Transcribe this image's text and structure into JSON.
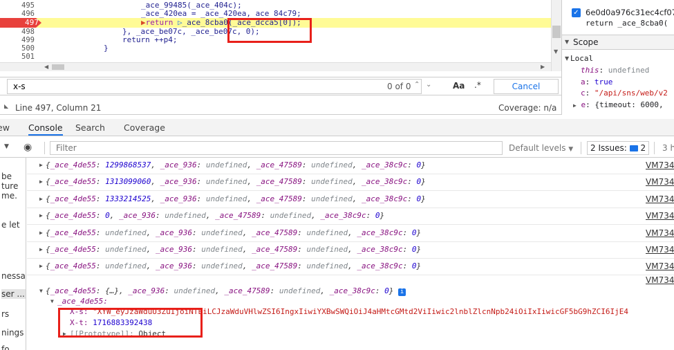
{
  "editor": {
    "breakpoint_label": "497",
    "lines": [
      {
        "num": "495",
        "code": "_ace_99485(_ace_404c);"
      },
      {
        "num": "496",
        "code": "_ace_420ea = _ace_420ea, ace 84c79;"
      },
      {
        "num": "497",
        "code_prefix": "return ",
        "code_fn": "_ace_8cba0(",
        "code_arg": "_ace_dcca5[0]",
        "code_suffix": ");"
      },
      {
        "num": "498",
        "code": "}, _ace_be07c, _ace_be07c, 0);"
      },
      {
        "num": "499",
        "code": "return ++p4;"
      },
      {
        "num": "500",
        "code": "}"
      },
      {
        "num": "501",
        "code": ""
      }
    ]
  },
  "find": {
    "value": "x-s",
    "result": "0 of 0",
    "case_label": "Aa",
    "regex_label": ".*",
    "cancel_label": "Cancel"
  },
  "status": {
    "position": "Line 497, Column 21",
    "coverage": "Coverage: n/a"
  },
  "right_panel": {
    "callstack_line1": "6e0d0a976c31ec4cf07",
    "callstack_line2": "return _ace_8cba0(",
    "scope_label": "Scope",
    "local_label": "Local",
    "scope_items": [
      {
        "key": "this",
        "value": "undefined"
      },
      {
        "key": "a",
        "value": "true"
      },
      {
        "key": "c",
        "value": "\"/api/sns/web/v2"
      },
      {
        "key": "e",
        "value": "{timeout: 6000,"
      }
    ]
  },
  "tabs": {
    "partial_left": "ew",
    "console": "Console",
    "search": "Search",
    "coverage": "Coverage"
  },
  "filter": {
    "placeholder": "Filter",
    "levels": "Default levels",
    "issues_text": "2 Issues:",
    "issues_count": "2",
    "hidden": "3 h"
  },
  "left_column": [
    "be",
    "ture",
    "me.",
    "e let",
    "nessa...",
    "ser ...",
    "rs",
    "nings",
    "fo"
  ],
  "console_rows": [
    {
      "n1": "1299868537",
      "n1_kind": "n",
      "link": "VM7348"
    },
    {
      "n1": "1313099060",
      "n1_kind": "n",
      "link": "VM7348"
    },
    {
      "n1": "1333214525",
      "n1_kind": "n",
      "link": "VM7348"
    },
    {
      "n1": "0",
      "n1_kind": "n",
      "link": "VM7348"
    },
    {
      "n1": "undefined",
      "n1_kind": "u",
      "link": "VM7348"
    },
    {
      "n1": "undefined",
      "n1_kind": "u",
      "link": "VM7348"
    },
    {
      "n1": "undefined",
      "n1_kind": "u",
      "link": "VM7348"
    }
  ],
  "expanded": {
    "link": "VM7348",
    "summary_key": "_ace_4de55",
    "summary_val": "{…}",
    "child_key": "_ace_4de55:",
    "xs_key": "X-s:",
    "xs_val": "\"XYW_eyJzaWduU3ZuIjoiNTEiLCJzaWduVHlwZSI6IngxIiwiYXBwSWQiOiJ4aHMtcGMtd2ViIiwic2lnblZlcnNpb24iOiIxIiwicGF5bG9hZCI6IjE4",
    "xt_key": "X-t:",
    "xt_val": "1716883392438",
    "proto_key": "[[Prototype]]:",
    "proto_val": "Object"
  },
  "common_keys": {
    "k1": "_ace_4de55",
    "k2": "_ace_936",
    "k3": "_ace_47589",
    "k4": "_ace_38c9c",
    "undef": "undefined",
    "zero": "0"
  }
}
